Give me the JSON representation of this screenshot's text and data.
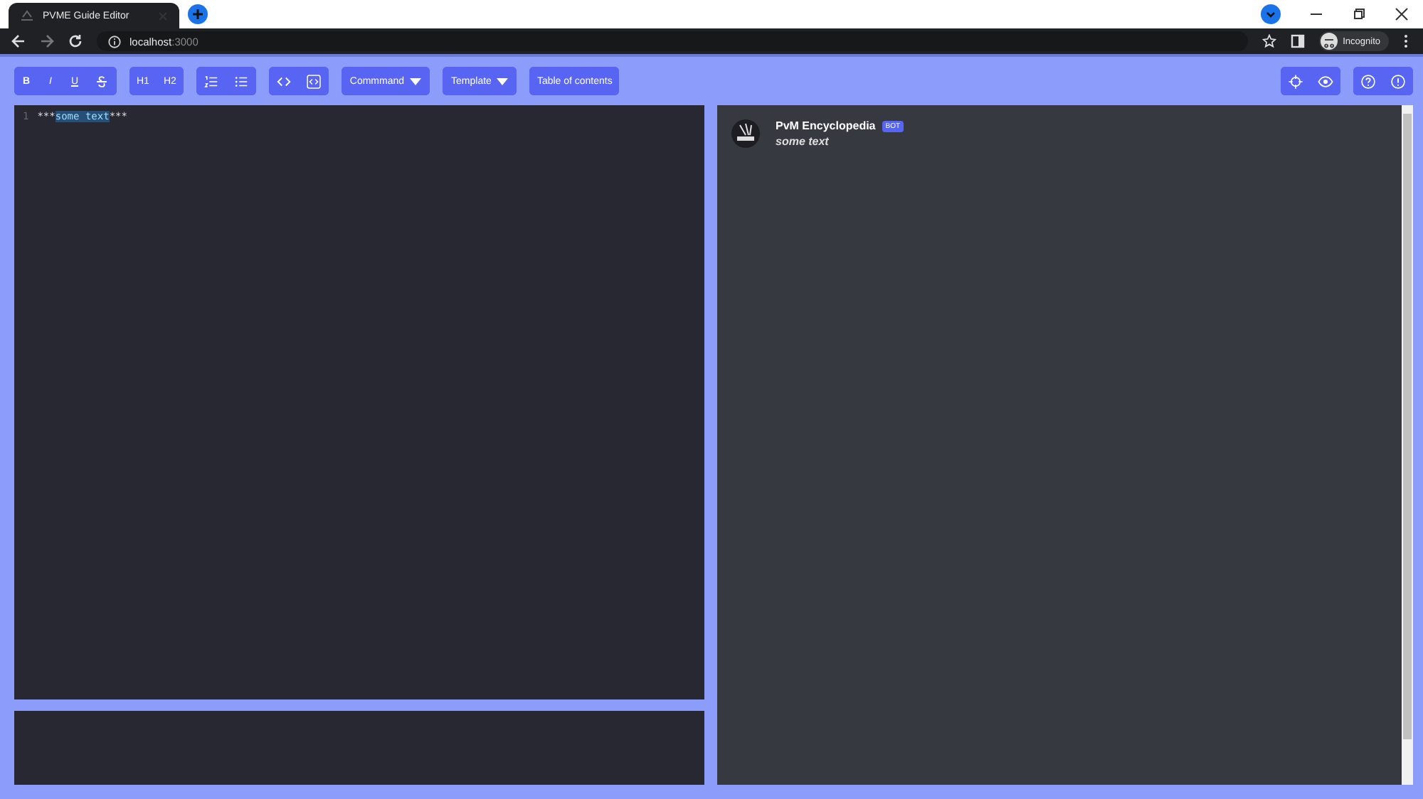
{
  "browser": {
    "tab_title": "PVME Guide Editor",
    "url_host": "localhost",
    "url_port": ":3000",
    "profile": "Incognito"
  },
  "toolbar": {
    "groups": [
      {
        "buttons": [
          {
            "kind": "text",
            "label": "B"
          },
          {
            "kind": "text",
            "label": "I"
          },
          {
            "kind": "text",
            "label": "U"
          },
          {
            "kind": "icon"
          }
        ]
      },
      {
        "buttons": [
          {
            "kind": "text",
            "label": "H1"
          },
          {
            "kind": "text",
            "label": "H2"
          }
        ]
      },
      {
        "buttons": [
          {
            "kind": "icon"
          },
          {
            "kind": "icon"
          }
        ]
      },
      {
        "buttons": [
          {
            "kind": "icon"
          },
          {
            "kind": "icon"
          }
        ]
      },
      {
        "buttons": [
          {
            "kind": "dropdown",
            "label": "Commmand"
          }
        ]
      },
      {
        "buttons": [
          {
            "kind": "dropdown",
            "label": "Template"
          }
        ]
      },
      {
        "buttons": [
          {
            "kind": "text",
            "label": "Table of contents"
          }
        ]
      }
    ],
    "right_groups": [
      {
        "buttons": [
          {
            "kind": "icon"
          },
          {
            "kind": "icon"
          }
        ]
      },
      {
        "buttons": [
          {
            "kind": "icon"
          },
          {
            "kind": "icon"
          }
        ]
      }
    ]
  },
  "editor": {
    "lines": [
      {
        "number": "1",
        "segments": [
          {
            "text": "***",
            "selected": false
          },
          {
            "text": "some text",
            "selected": true
          },
          {
            "text": "***",
            "selected": false
          }
        ]
      }
    ]
  },
  "preview": {
    "author": "PvM Encyclopedia",
    "badge": "BOT",
    "message": "some text"
  }
}
